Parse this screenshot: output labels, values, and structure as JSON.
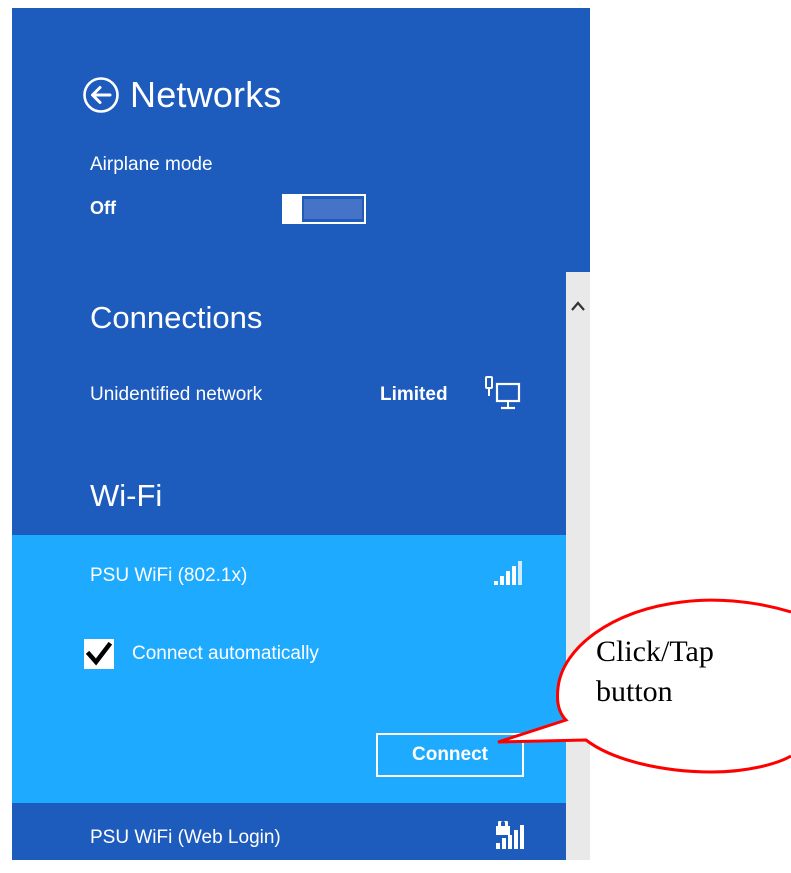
{
  "panel": {
    "title": "Networks",
    "bg_color": "#1d5bbd",
    "selected_bg_color": "#1eabff"
  },
  "airplane": {
    "label": "Airplane mode",
    "state": "Off"
  },
  "connections": {
    "heading": "Connections",
    "items": [
      {
        "name": "Unidentified network",
        "status": "Limited",
        "icon": "wired-network-icon"
      }
    ]
  },
  "wifi": {
    "heading": "Wi-Fi",
    "selected": {
      "name": "PSU WiFi (802.1x)",
      "icon": "wifi-signal-icon",
      "auto_connect_label": "Connect automatically",
      "auto_connect_checked": true,
      "connect_label": "Connect"
    },
    "others": [
      {
        "name": "PSU WiFi (Web Login)",
        "icon": "wifi-signal-secured-icon"
      }
    ]
  },
  "callout": {
    "line1": "Click/Tap",
    "line2": "button",
    "border_color": "#ff0000"
  }
}
